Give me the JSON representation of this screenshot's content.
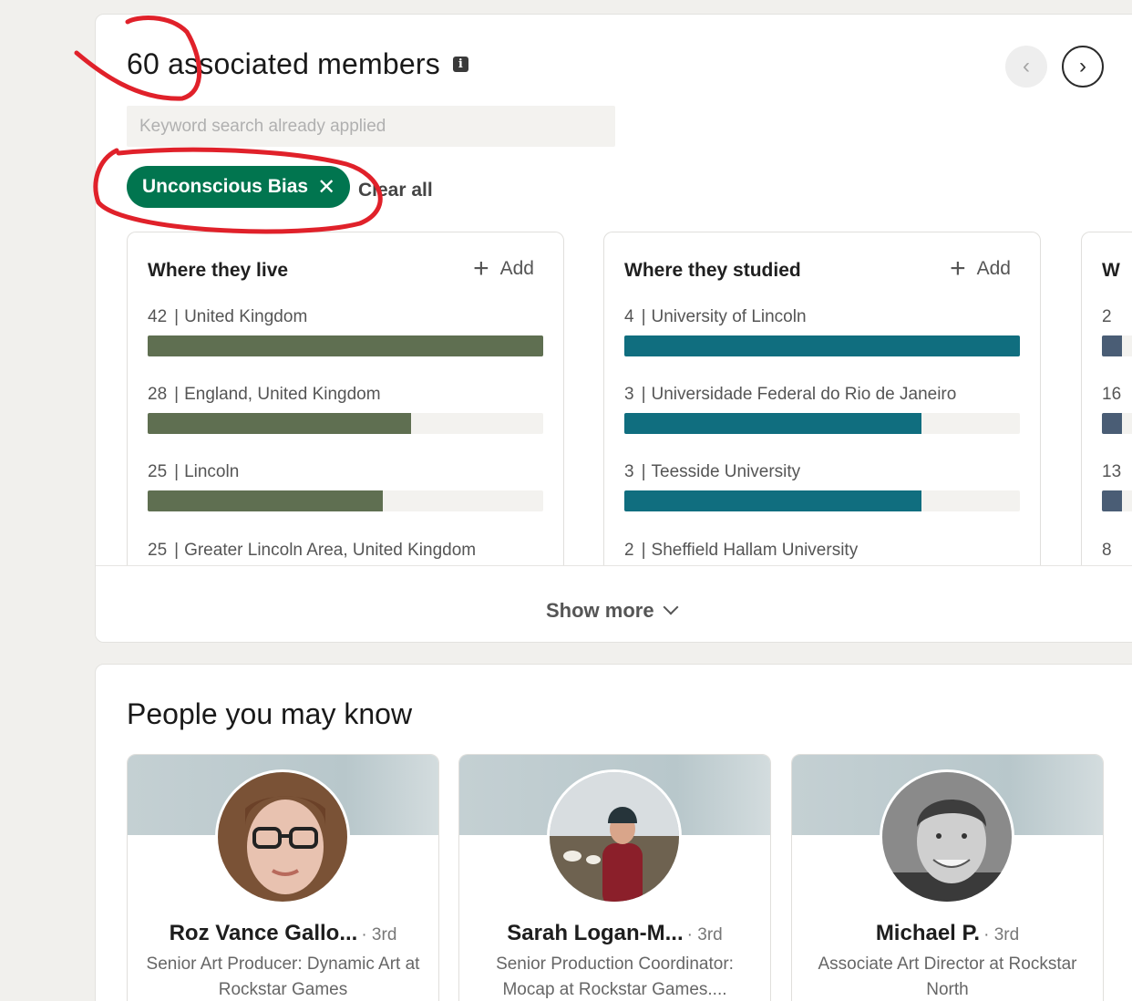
{
  "members": {
    "count_title": "60 associated members",
    "search_placeholder": "Keyword search already applied",
    "filter_pill": "Unconscious Bias",
    "clear_all": "Clear all",
    "show_more": "Show more",
    "facets": [
      {
        "title": "Where they live",
        "add_label": "Add",
        "bar_color": "#5f6f51",
        "rows": [
          {
            "count": "42",
            "label": "United Kingdom",
            "fraction": 1.0
          },
          {
            "count": "28",
            "label": "England, United Kingdom",
            "fraction": 0.667
          },
          {
            "count": "25",
            "label": "Lincoln",
            "fraction": 0.595
          },
          {
            "count": "25",
            "label": "Greater Lincoln Area, United Kingdom",
            "fraction": 0.595
          }
        ]
      },
      {
        "title": "Where they studied",
        "add_label": "Add",
        "bar_color": "#106e7f",
        "rows": [
          {
            "count": "4",
            "label": "University of Lincoln",
            "fraction": 1.0
          },
          {
            "count": "3",
            "label": "Universidade Federal do Rio de Janeiro",
            "fraction": 0.75
          },
          {
            "count": "3",
            "label": "Teesside University",
            "fraction": 0.75
          },
          {
            "count": "2",
            "label": "Sheffield Hallam University",
            "fraction": 0.5
          }
        ]
      },
      {
        "title": "W",
        "bar_color": "#4a5d75",
        "rows": [
          {
            "count": "2",
            "fraction": 0.05
          },
          {
            "count": "16",
            "fraction": 0.05
          },
          {
            "count": "13",
            "fraction": 0.05
          },
          {
            "count": "8",
            "fraction": 0.05
          }
        ]
      }
    ]
  },
  "people": {
    "title": "People you may know",
    "cards": [
      {
        "name": "Roz Vance Gallo...",
        "degree": "· 3rd",
        "headline": "Senior Art Producer: Dynamic Art at Rockstar Games"
      },
      {
        "name": "Sarah Logan-M...",
        "degree": "· 3rd",
        "headline": "Senior Production Coordinator: Mocap at Rockstar Games...."
      },
      {
        "name": "Michael P.",
        "degree": "· 3rd",
        "headline": "Associate Art Director at Rockstar North"
      }
    ]
  }
}
